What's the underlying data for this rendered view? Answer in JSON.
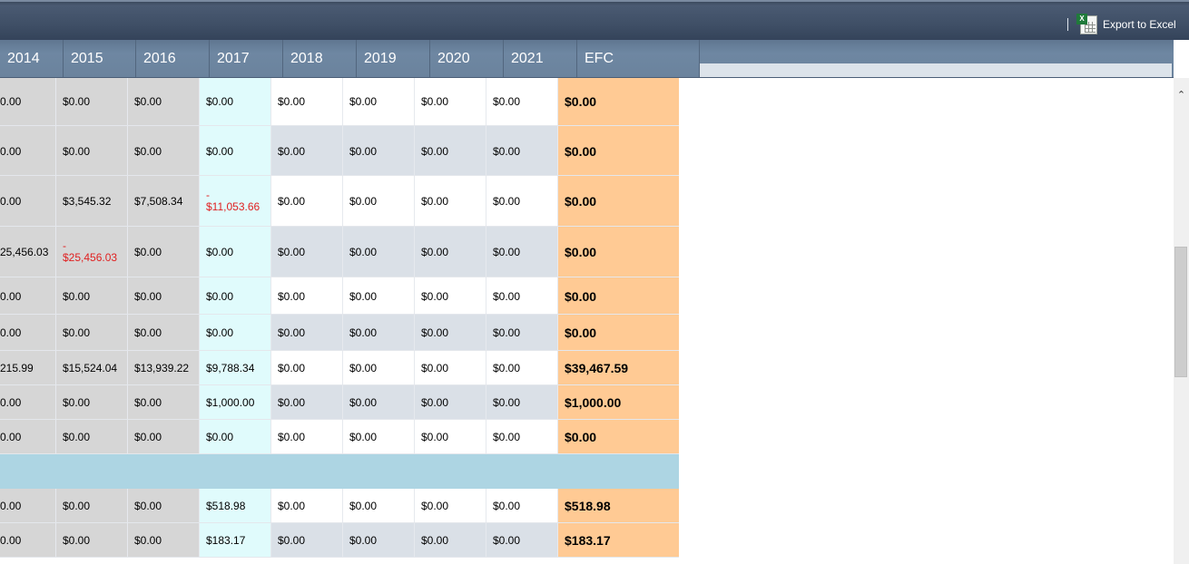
{
  "toolbar": {
    "export_label": "Export to Excel"
  },
  "columns": [
    "2014",
    "2015",
    "2016",
    "2017",
    "2018",
    "2019",
    "2020",
    "2021",
    "EFC"
  ],
  "rows": [
    [
      "0.00",
      "$0.00",
      "$0.00",
      "$0.00",
      "$0.00",
      "$0.00",
      "$0.00",
      "$0.00",
      "$0.00"
    ],
    [
      "0.00",
      "$0.00",
      "$0.00",
      "$0.00",
      "$0.00",
      "$0.00",
      "$0.00",
      "$0.00",
      "$0.00"
    ],
    [
      "0.00",
      "$3,545.32",
      "$7,508.34",
      "$11,053.66",
      "$0.00",
      "$0.00",
      "$0.00",
      "$0.00",
      "$0.00"
    ],
    [
      "25,456.03",
      "$25,456.03",
      "$0.00",
      "$0.00",
      "$0.00",
      "$0.00",
      "$0.00",
      "$0.00",
      "$0.00"
    ],
    [
      "0.00",
      "$0.00",
      "$0.00",
      "$0.00",
      "$0.00",
      "$0.00",
      "$0.00",
      "$0.00",
      "$0.00"
    ],
    [
      "0.00",
      "$0.00",
      "$0.00",
      "$0.00",
      "$0.00",
      "$0.00",
      "$0.00",
      "$0.00",
      "$0.00"
    ],
    [
      "215.99",
      "$15,524.04",
      "$13,939.22",
      "$9,788.34",
      "$0.00",
      "$0.00",
      "$0.00",
      "$0.00",
      "$39,467.59"
    ],
    [
      "0.00",
      "$0.00",
      "$0.00",
      "$1,000.00",
      "$0.00",
      "$0.00",
      "$0.00",
      "$0.00",
      "$1,000.00"
    ],
    [
      "0.00",
      "$0.00",
      "$0.00",
      "$0.00",
      "$0.00",
      "$0.00",
      "$0.00",
      "$0.00",
      "$0.00"
    ],
    null,
    [
      "0.00",
      "$0.00",
      "$0.00",
      "$518.98",
      "$0.00",
      "$0.00",
      "$0.00",
      "$0.00",
      "$518.98"
    ],
    [
      "0.00",
      "$0.00",
      "$0.00",
      "$183.17",
      "$0.00",
      "$0.00",
      "$0.00",
      "$0.00",
      "$183.17"
    ]
  ],
  "negative_cells": [
    [
      2,
      3
    ],
    [
      3,
      1
    ]
  ],
  "negative_prefix": "-",
  "colors": {
    "past_col_bg": "#d6d6d6",
    "current_col_bg": "#e0fbfc",
    "future_even_bg": "#ffffff",
    "future_odd_bg": "#dae0e7",
    "efc_bg": "#ffca94",
    "group_band": "#add5e3",
    "negative_text": "#e02020"
  }
}
